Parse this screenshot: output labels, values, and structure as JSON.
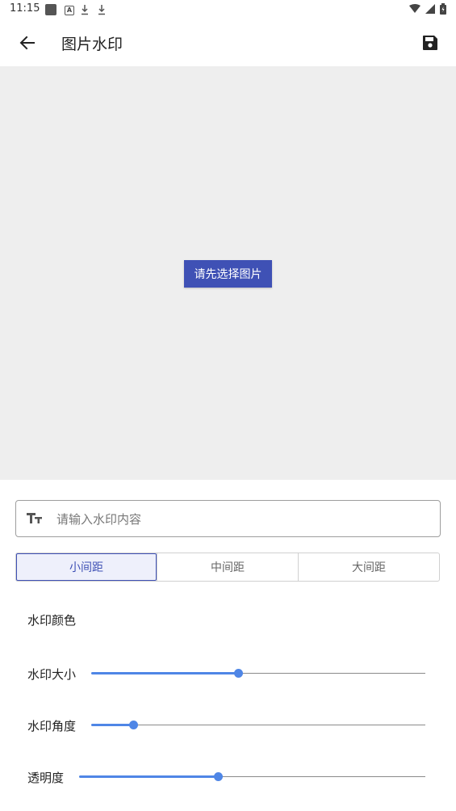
{
  "status_bar": {
    "time": "11:15",
    "left_icons": [
      "notification-square-icon",
      "a-icon",
      "download-icon",
      "download-icon"
    ],
    "right_icons": [
      "wifi-icon",
      "signal-icon",
      "battery-icon"
    ]
  },
  "app_bar": {
    "title": "图片水印",
    "back_icon": "arrow-left-icon",
    "save_icon": "save-icon"
  },
  "preview": {
    "select_button_label": "请先选择图片",
    "background_color": "#eeeeee",
    "button_color": "#3f51b5"
  },
  "watermark_input": {
    "icon": "text-size-icon",
    "placeholder": "请输入水印内容",
    "value": ""
  },
  "spacing": {
    "options": [
      "小间距",
      "中间距",
      "大间距"
    ],
    "selected": "小间距"
  },
  "settings": {
    "color_label": "水印颜色",
    "size": {
      "label": "水印大小",
      "value": 0.44
    },
    "angle": {
      "label": "水印角度",
      "value": 0.125
    },
    "opacity": {
      "label": "透明度",
      "value": 0.4
    }
  },
  "accent_color": "#4f86e6"
}
